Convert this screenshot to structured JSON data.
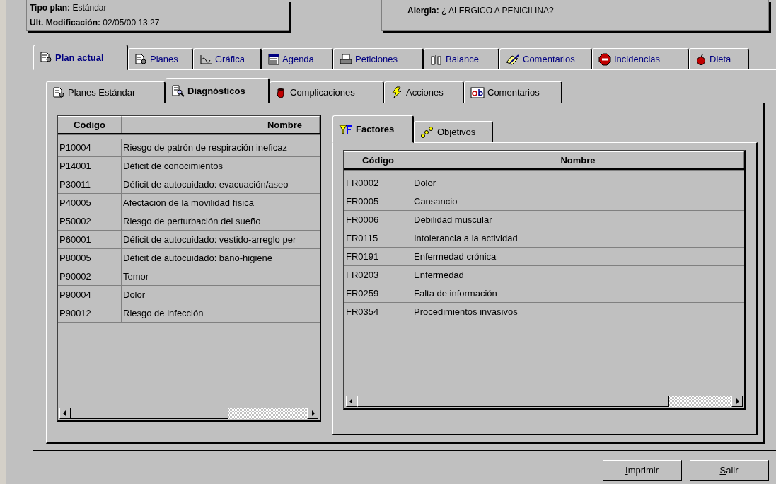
{
  "header": {
    "left": [
      {
        "label": "Tipo plan:",
        "value": "Estándar"
      },
      {
        "label": "Ult. Modificación:",
        "value": "02/05/00 13:27"
      }
    ],
    "right": {
      "label": "Alergia:",
      "value": "¿ ALERGICO A PENICILINA?"
    }
  },
  "main_tabs": [
    {
      "label": "Plan actual",
      "selected": true
    },
    {
      "label": "Planes",
      "selected": false
    },
    {
      "label": "Gráfica",
      "selected": false
    },
    {
      "label": "Agenda",
      "selected": false
    },
    {
      "label": "Peticiones",
      "selected": false
    },
    {
      "label": "Balance",
      "selected": false
    },
    {
      "label": "Comentarios",
      "selected": false
    },
    {
      "label": "Incidencias",
      "selected": false
    },
    {
      "label": "Dieta",
      "selected": false
    }
  ],
  "sub_tabs": [
    {
      "label": "Planes Estándar",
      "selected": false
    },
    {
      "label": "Diagnósticos",
      "selected": true
    },
    {
      "label": "Complicaciones",
      "selected": false
    },
    {
      "label": "Acciones",
      "selected": false
    },
    {
      "label": "Comentarios",
      "selected": false
    }
  ],
  "diagnosticos": {
    "columns": [
      "Código",
      "Nombre"
    ],
    "rows": [
      [
        "P10004",
        "Riesgo de patrón de respiración ineficaz"
      ],
      [
        "P14001",
        "Déficit de conocimientos"
      ],
      [
        "P30011",
        "Déficit de autocuidado: evacuación/aseo"
      ],
      [
        "P40005",
        "Afectación de la movilidad física"
      ],
      [
        "P50002",
        "Riesgo de perturbación del sueño"
      ],
      [
        "P60001",
        "Déficit de autocuidado: vestido-arreglo per"
      ],
      [
        "P80005",
        "Déficit de autocuidado: baño-higiene"
      ],
      [
        "P90002",
        "Temor"
      ],
      [
        "P90004",
        "Dolor"
      ],
      [
        "P90012",
        "Riesgo de infección"
      ]
    ]
  },
  "detail_tabs": [
    {
      "label": "Factores",
      "selected": true
    },
    {
      "label": "Objetivos",
      "selected": false
    }
  ],
  "factores": {
    "columns": [
      "Código",
      "Nombre"
    ],
    "rows": [
      [
        "FR0002",
        "Dolor"
      ],
      [
        "FR0005",
        "Cansancio"
      ],
      [
        "FR0006",
        "Debilidad muscular"
      ],
      [
        "FR0115",
        "Intolerancia a la actividad"
      ],
      [
        "FR0191",
        "Enfermedad crónica"
      ],
      [
        "FR0203",
        "Enfermedad"
      ],
      [
        "FR0259",
        "Falta de información"
      ],
      [
        "FR0354",
        "Procedimientos invasivos"
      ]
    ]
  },
  "buttons": [
    "Imprimir",
    "Salir"
  ]
}
